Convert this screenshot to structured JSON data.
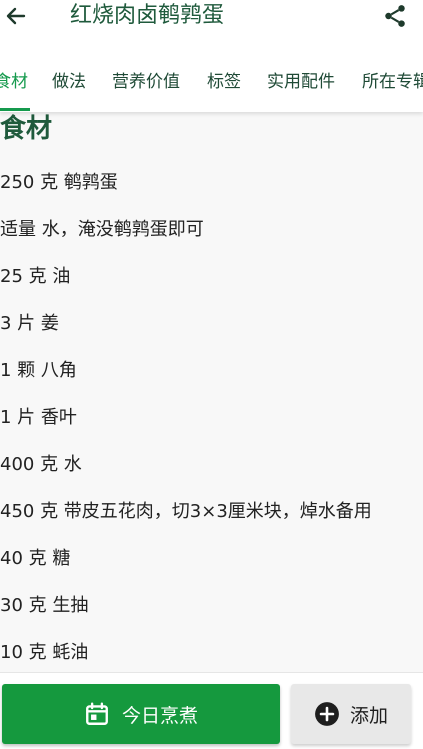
{
  "header": {
    "title": "红烧肉卤鹌鹑蛋",
    "back_icon": "arrow-left-icon",
    "share_icon": "share-icon"
  },
  "tabs": [
    {
      "label": "食材",
      "active": true
    },
    {
      "label": "做法",
      "active": false
    },
    {
      "label": "营养价值",
      "active": false
    },
    {
      "label": "标签",
      "active": false
    },
    {
      "label": "实用配件",
      "active": false
    },
    {
      "label": "所在专辑",
      "active": false
    }
  ],
  "main": {
    "section_title": "食材",
    "ingredients": [
      "250 克 鹌鹑蛋",
      "适量 水，淹没鹌鹑蛋即可",
      "25 克 油",
      "3 片 姜",
      "1 颗 八角",
      "1 片 香叶",
      "400 克 水",
      "450 克 带皮五花肉，切3×3厘米块，焯水备用",
      "40 克 糖",
      "30 克 生抽",
      "10 克 蚝油"
    ]
  },
  "bottom": {
    "cook_label": "今日烹煮",
    "cook_icon": "calendar-icon",
    "add_label": "添加",
    "add_icon": "plus-circle-icon"
  },
  "colors": {
    "accent": "#159a4d",
    "title": "#1f5a3c",
    "cook_button": "#15993e",
    "add_button": "#e8e8e8"
  }
}
